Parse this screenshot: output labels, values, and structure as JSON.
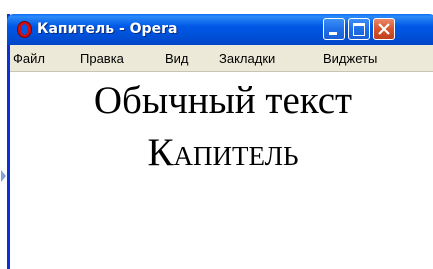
{
  "window": {
    "title": "Капитель - Opera",
    "icon": "opera-icon",
    "controls": {
      "minimize": "minimize-icon",
      "maximize": "maximize-icon",
      "close": "close-icon"
    }
  },
  "menu": {
    "items": [
      "Файл",
      "Правка",
      "Вид",
      "Закладки",
      "Виджеты"
    ]
  },
  "content": {
    "normal_text": "Обычный текст",
    "smallcaps_text": "Капитель"
  },
  "colors": {
    "titlebar": "#0058e6",
    "close_button": "#d8542e",
    "menubar_bg": "#ece9d8",
    "opera_red": "#cc0f16"
  }
}
